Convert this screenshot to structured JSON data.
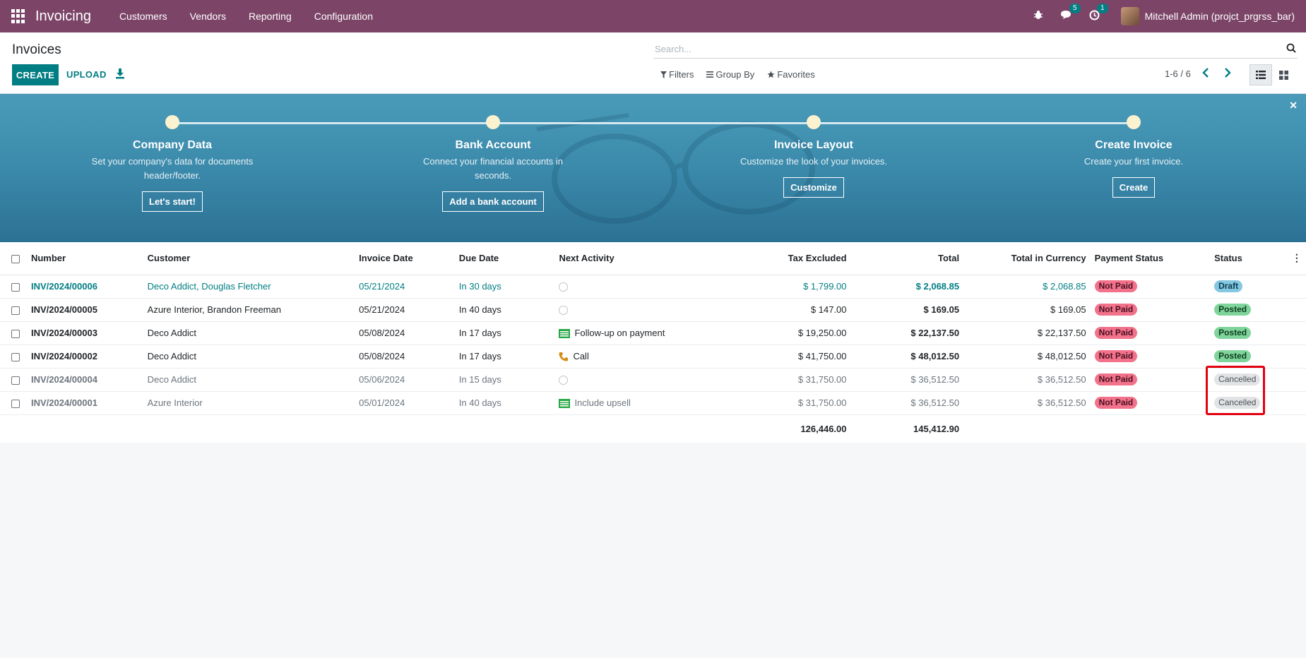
{
  "navbar": {
    "app_name": "Invoicing",
    "menu": [
      "Customers",
      "Vendors",
      "Reporting",
      "Configuration"
    ],
    "messages_badge": "5",
    "activities_badge": "1",
    "user": "Mitchell Admin (projct_prgrss_bar)"
  },
  "control": {
    "title": "Invoices",
    "create_label": "CREATE",
    "upload_label": "UPLOAD",
    "search_placeholder": "Search...",
    "filters_label": "Filters",
    "groupby_label": "Group By",
    "favorites_label": "Favorites",
    "pager": "1-6 / 6"
  },
  "banner": {
    "steps": [
      {
        "title": "Company Data",
        "desc": "Set your company's data for documents header/footer.",
        "button": "Let's start!"
      },
      {
        "title": "Bank Account",
        "desc": "Connect your financial accounts in seconds.",
        "button": "Add a bank account"
      },
      {
        "title": "Invoice Layout",
        "desc": "Customize the look of your invoices.",
        "button": "Customize"
      },
      {
        "title": "Create Invoice",
        "desc": "Create your first invoice.",
        "button": "Create"
      }
    ]
  },
  "table": {
    "headers": [
      "Number",
      "Customer",
      "Invoice Date",
      "Due Date",
      "Next Activity",
      "Tax Excluded",
      "Total",
      "Total in Currency",
      "Payment Status",
      "Status"
    ],
    "rows": [
      {
        "number": "INV/2024/00006",
        "customer": "Deco Addict, Douglas Fletcher",
        "invoice_date": "05/21/2024",
        "due_date": "In 30 days",
        "activity": "",
        "tax_excluded": "$ 1,799.00",
        "total": "$ 2,068.85",
        "total_currency": "$ 2,068.85",
        "payment_status": "Not Paid",
        "status": "Draft"
      },
      {
        "number": "INV/2024/00005",
        "customer": "Azure Interior, Brandon Freeman",
        "invoice_date": "05/21/2024",
        "due_date": "In 40 days",
        "activity": "",
        "tax_excluded": "$ 147.00",
        "total": "$ 169.05",
        "total_currency": "$ 169.05",
        "payment_status": "Not Paid",
        "status": "Posted"
      },
      {
        "number": "INV/2024/00003",
        "customer": "Deco Addict",
        "invoice_date": "05/08/2024",
        "due_date": "In 17 days",
        "activity": "Follow-up on payment",
        "tax_excluded": "$ 19,250.00",
        "total": "$ 22,137.50",
        "total_currency": "$ 22,137.50",
        "payment_status": "Not Paid",
        "status": "Posted"
      },
      {
        "number": "INV/2024/00002",
        "customer": "Deco Addict",
        "invoice_date": "05/08/2024",
        "due_date": "In 17 days",
        "activity": "Call",
        "tax_excluded": "$ 41,750.00",
        "total": "$ 48,012.50",
        "total_currency": "$ 48,012.50",
        "payment_status": "Not Paid",
        "status": "Posted"
      },
      {
        "number": "INV/2024/00004",
        "customer": "Deco Addict",
        "invoice_date": "05/06/2024",
        "due_date": "In 15 days",
        "activity": "",
        "tax_excluded": "$ 31,750.00",
        "total": "$ 36,512.50",
        "total_currency": "$ 36,512.50",
        "payment_status": "Not Paid",
        "status": "Cancelled"
      },
      {
        "number": "INV/2024/00001",
        "customer": "Azure Interior",
        "invoice_date": "05/01/2024",
        "due_date": "In 40 days",
        "activity": "Include upsell",
        "tax_excluded": "$ 31,750.00",
        "total": "$ 36,512.50",
        "total_currency": "$ 36,512.50",
        "payment_status": "Not Paid",
        "status": "Cancelled"
      }
    ],
    "totals": {
      "tax_excluded": "126,446.00",
      "total": "145,412.90"
    }
  },
  "colors": {
    "navbar": "#7c4568",
    "primary": "#017e84",
    "highlight": "#e3000f"
  }
}
